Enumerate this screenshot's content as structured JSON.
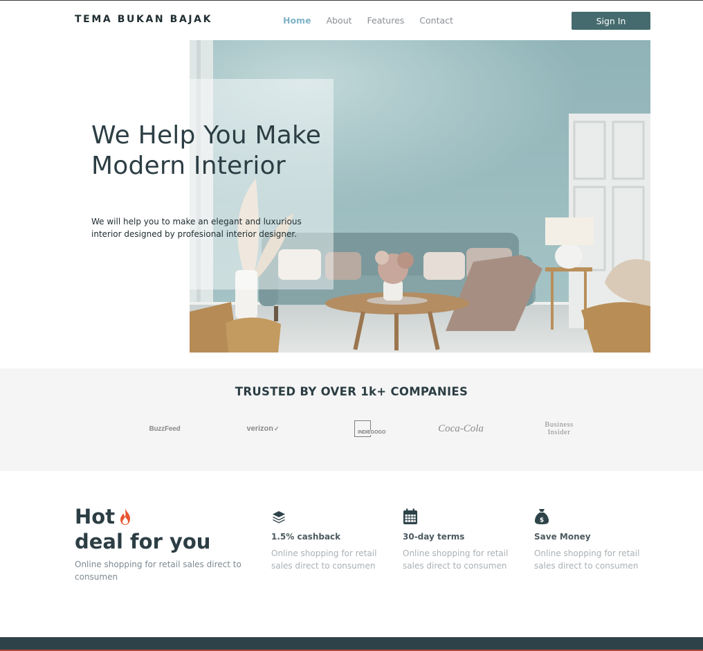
{
  "header": {
    "brand": "TEMA BUKAN BAJAK",
    "nav": [
      "Home",
      "About",
      "Features",
      "Contact"
    ],
    "active_nav": "Home",
    "signin_label": "Sign In"
  },
  "hero": {
    "title": "We Help You Make Modern Interior",
    "subtitle": "We will help you to make an elegant and luxurious interior designed by profesional interior designer."
  },
  "trusted": {
    "title": "TRUSTED BY OVER 1k+ COMPANIES",
    "logos": [
      "BuzzFeed",
      "verizon",
      "INDIEGOGO",
      "Coca-Cola",
      "Business Insider"
    ]
  },
  "hot_deal": {
    "title_line1": "Hot",
    "title_line2": "deal for you",
    "subtitle": "Online shopping for retail sales direct to consumen",
    "features": [
      {
        "icon": "layers-icon",
        "title": "1.5% cashback",
        "desc": "Online shopping for retail sales direct to consumen"
      },
      {
        "icon": "calendar-icon",
        "title": "30-day terms",
        "desc": "Online shopping for retail sales direct to consumen"
      },
      {
        "icon": "money-bag-icon",
        "title": "Save Money",
        "desc": "Online shopping for retail sales direct to consumen"
      }
    ]
  },
  "colors": {
    "primary": "#456b6e",
    "heading": "#2c3e44",
    "nav_active": "#7fb3c8",
    "footer": "#2e4349",
    "trusted_bg": "#f5f5f5"
  }
}
